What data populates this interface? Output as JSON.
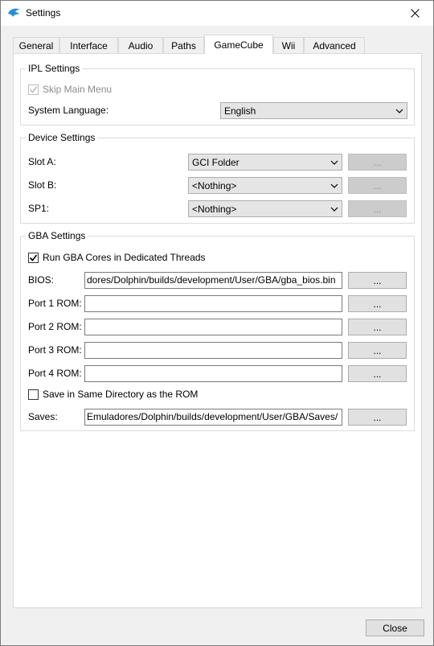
{
  "window": {
    "title": "Settings",
    "icon": "dolphin-icon"
  },
  "tabs": [
    {
      "label": "General"
    },
    {
      "label": "Interface"
    },
    {
      "label": "Audio"
    },
    {
      "label": "Paths"
    },
    {
      "label": "GameCube"
    },
    {
      "label": "Wii"
    },
    {
      "label": "Advanced"
    }
  ],
  "active_tab": "GameCube",
  "ipl": {
    "title": "IPL Settings",
    "skip_main_menu": "Skip Main Menu",
    "system_language_label": "System Language:",
    "system_language_value": "English"
  },
  "device": {
    "title": "Device Settings",
    "slot_a_label": "Slot A:",
    "slot_a_value": "GCI Folder",
    "slot_b_label": "Slot B:",
    "slot_b_value": "<Nothing>",
    "sp1_label": "SP1:",
    "sp1_value": "<Nothing>",
    "browse_label": "..."
  },
  "gba": {
    "title": "GBA Settings",
    "dedicated_threads": "Run GBA Cores in Dedicated Threads",
    "bios_label": "BIOS:",
    "bios_value": "dores/Dolphin/builds/development/User/GBA/gba_bios.bin",
    "port1_label": "Port 1 ROM:",
    "port2_label": "Port 2 ROM:",
    "port3_label": "Port 3 ROM:",
    "port4_label": "Port 4 ROM:",
    "port1_value": "",
    "port2_value": "",
    "port3_value": "",
    "port4_value": "",
    "same_dir": "Save in Same Directory as the ROM",
    "saves_label": "Saves:",
    "saves_value": "Emuladores/Dolphin/builds/development/User/GBA/Saves/",
    "browse_label": "..."
  },
  "footer": {
    "close_label": "Close"
  }
}
